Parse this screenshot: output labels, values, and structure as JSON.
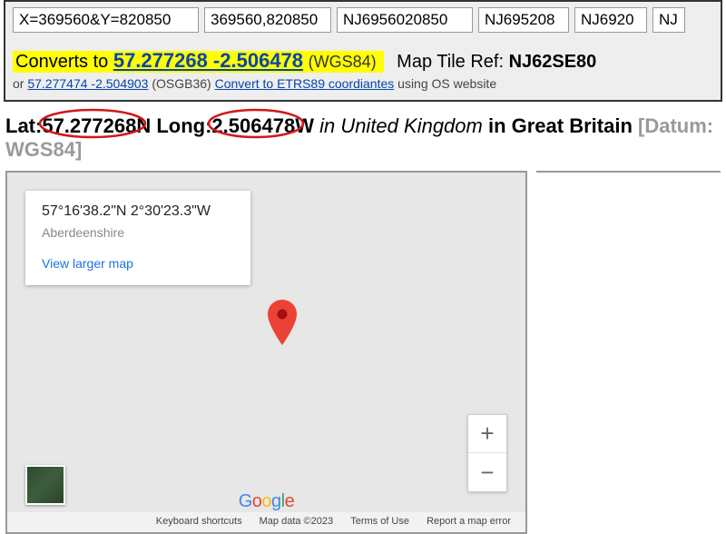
{
  "inputs": {
    "xy": "X=369560&Y=820850",
    "pair": "369560,820850",
    "grid1": "NJ6956020850",
    "grid2": "NJ695208",
    "grid3": "NJ6920",
    "grid4": "NJ"
  },
  "convert": {
    "label": "Converts to ",
    "coords_link": "57.277268 -2.506478",
    "wgs": "(WGS84)",
    "tile_label": "Map Tile Ref: ",
    "tile_value": "NJ62SE80",
    "or": "or ",
    "osgb_link": "57.277474 -2.504903",
    "osgb_suffix": " (OSGB36) ",
    "etrs_link": "Convert to ETRS89 coordiantes",
    "etrs_suffix": " using OS website"
  },
  "latlong": {
    "lat_label": "Lat:",
    "lat_val": " 57.277268",
    "lat_dir": "N",
    "long_label": " Long:",
    "long_val": " 2.506478",
    "long_dir": "W",
    "country": " in United Kingdom",
    "region_suffix": " in Great Britain ",
    "datum": "[Datum: WGS84]"
  },
  "map": {
    "coord_dms": "57°16'38.2\"N 2°30'23.3\"W",
    "region": "Aberdeenshire",
    "view_larger": "View larger map",
    "google": {
      "g": "G",
      "o1": "o",
      "o2": "o",
      "g2": "g",
      "l": "l",
      "e": "e"
    },
    "footer": {
      "shortcuts": "Keyboard shortcuts",
      "mapdata": "Map data ©2023",
      "terms": "Terms of Use",
      "report": "Report a map error"
    },
    "zoom_in": "+",
    "zoom_out": "−"
  }
}
